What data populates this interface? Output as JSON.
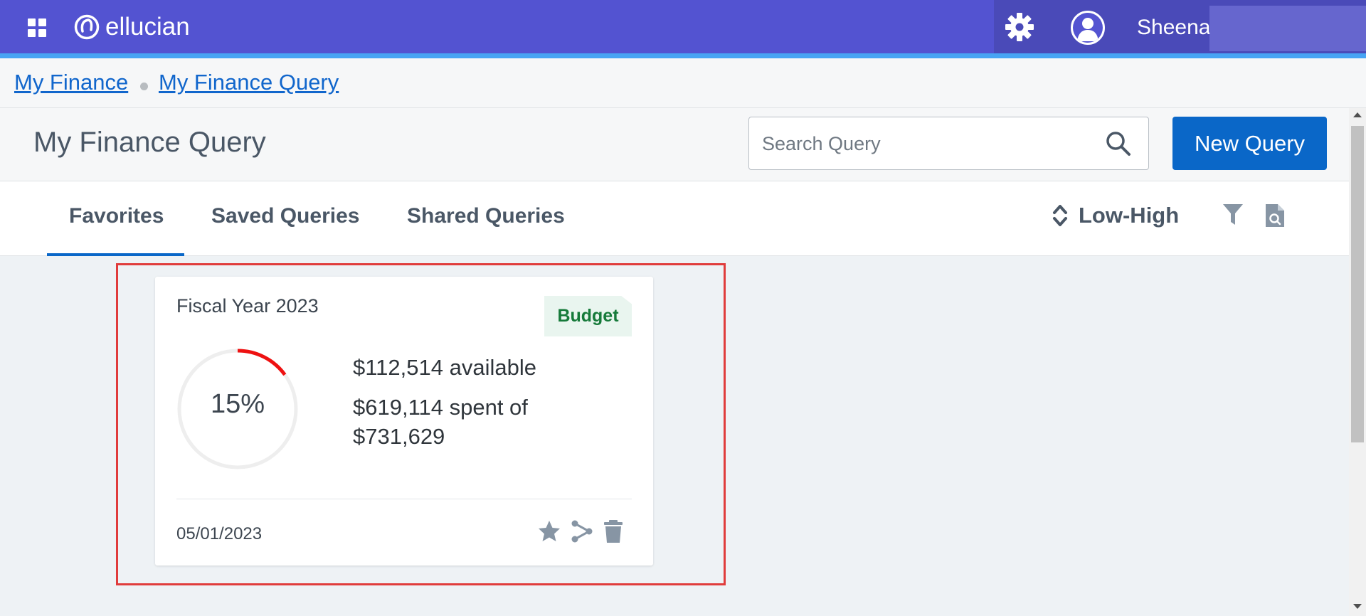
{
  "header": {
    "app_name": "ellucian",
    "user_name": "Sheena",
    "icons": [
      "apps-grid-icon",
      "ellucian-logo",
      "gear-icon",
      "user-avatar-icon"
    ],
    "colors": {
      "bar": "#5353d1",
      "accent_line": "#47a4f4"
    }
  },
  "breadcrumb": {
    "items": [
      {
        "label": "My Finance"
      },
      {
        "label": "My Finance Query"
      }
    ]
  },
  "page": {
    "title": "My Finance Query",
    "search": {
      "placeholder": "Search Query",
      "value": ""
    },
    "new_query_label": "New Query"
  },
  "tabs": {
    "items": [
      {
        "label": "Favorites",
        "active": true
      },
      {
        "label": "Saved Queries",
        "active": false
      },
      {
        "label": "Shared Queries",
        "active": false
      }
    ],
    "sort_label": "Low-High"
  },
  "card": {
    "title": "Fiscal Year 2023",
    "badge": "Budget",
    "percent_label": "15%",
    "percent_value": 15,
    "available": "$112,514 available",
    "spent": "$619,114 spent of $731,629",
    "date": "05/01/2023",
    "colors": {
      "progress": "#ee1111",
      "track": "#eeeeee",
      "badge_bg": "#e9f5ef",
      "badge_text": "#167a3a"
    }
  }
}
